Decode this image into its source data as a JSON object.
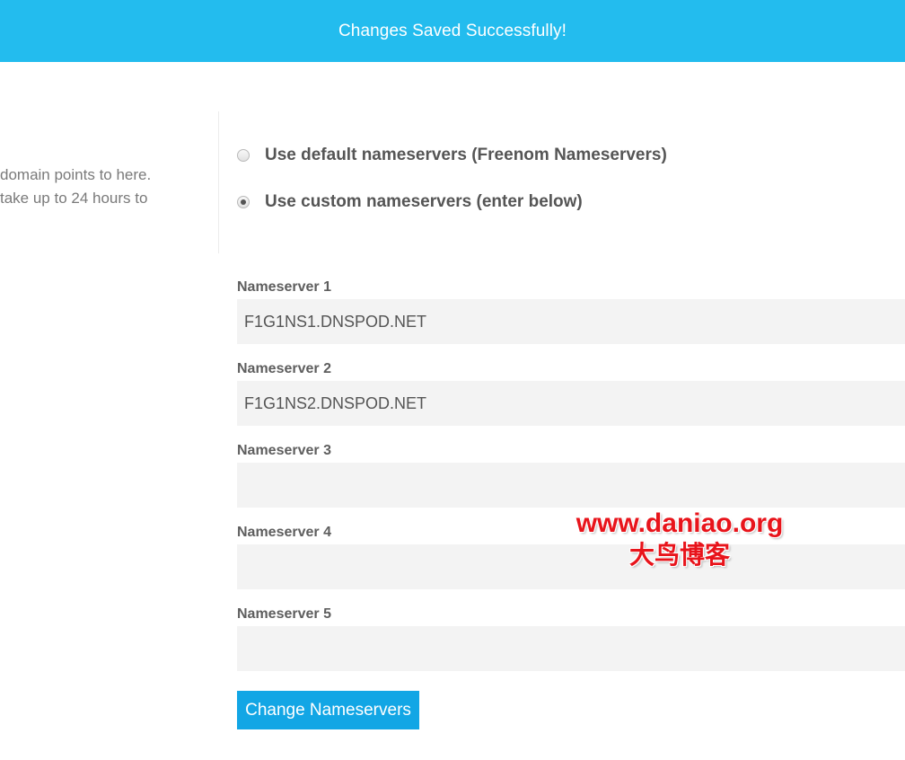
{
  "notification": {
    "message": "Changes Saved Successfully!"
  },
  "help": {
    "lines": [
      "domain points to here.",
      "take up to 24 hours to"
    ]
  },
  "radio_options": [
    {
      "label": "Use default nameservers (Freenom Nameservers)",
      "checked": false
    },
    {
      "label": "Use custom nameservers (enter below)",
      "checked": true
    }
  ],
  "nameservers": [
    {
      "label": "Nameserver 1",
      "value": "F1G1NS1.DNSPOD.NET"
    },
    {
      "label": "Nameserver 2",
      "value": "F1G1NS2.DNSPOD.NET"
    },
    {
      "label": "Nameserver 3",
      "value": ""
    },
    {
      "label": "Nameserver 4",
      "value": ""
    },
    {
      "label": "Nameserver 5",
      "value": ""
    }
  ],
  "submit_button": {
    "label": "Change Nameservers"
  },
  "watermark": {
    "url": "www.daniao.org",
    "name": "大鸟博客"
  },
  "colors": {
    "banner": "#23bcee",
    "button": "#12a6e5",
    "input_bg": "#f3f3f3",
    "watermark": "#e8141b"
  }
}
